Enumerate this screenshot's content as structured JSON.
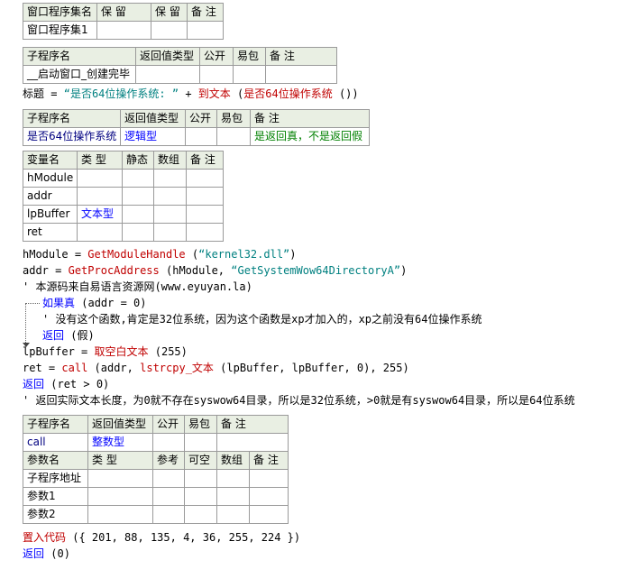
{
  "t1": {
    "header": [
      "窗口程序集名",
      "保 留",
      "保 留",
      "备 注"
    ],
    "row": [
      "窗口程序集1",
      "",
      "",
      ""
    ]
  },
  "t2": {
    "header": [
      "子程序名",
      "返回值类型",
      "公开",
      "易包",
      "备 注"
    ],
    "row": [
      "__启动窗口_创建完毕",
      "",
      "",
      "",
      ""
    ]
  },
  "line_title": {
    "target": "标题",
    "op": "=",
    "str": "“是否64位操作系统: ”",
    "plus": "+",
    "fn": "到文本",
    "arg_open": "(",
    "arg": "是否64位操作系统",
    "arg_close": "())"
  },
  "t3": {
    "header": [
      "子程序名",
      "返回值类型",
      "公开",
      "易包",
      "备 注"
    ],
    "row": [
      "是否64位操作系统",
      "逻辑型",
      "",
      "",
      "是返回真，不是返回假"
    ]
  },
  "t4": {
    "header": [
      "变量名",
      "类 型",
      "静态",
      "数组",
      "备 注"
    ],
    "rows": [
      [
        "hModule",
        "",
        "",
        "",
        ""
      ],
      [
        "addr",
        "",
        "",
        "",
        ""
      ],
      [
        "lpBuffer",
        "文本型",
        "",
        "",
        ""
      ],
      [
        "ret",
        "",
        "",
        "",
        ""
      ]
    ]
  },
  "code": {
    "l1": {
      "a": "hModule",
      "op": "=",
      "fn": "GetModuleHandle",
      "rest_a": "(",
      "str": "“kernel32.dll”",
      "rest_b": ")"
    },
    "l2": {
      "a": "addr",
      "op": "=",
      "fn": "GetProcAddress",
      "rest_a": "(hModule,",
      "str": "“GetSystemWow64DirectoryA”",
      "rest_b": ")"
    },
    "l3": "' 本源码来自易语言资源网(www.eyuyan.la)",
    "l4": {
      "kw": "如果真",
      "rest": "(addr = 0)"
    },
    "l5": "' 没有这个函数,肯定是32位系统，因为这个函数是xp才加入的，xp之前没有64位操作系统",
    "l6": {
      "kw": "返回",
      "rest": "(假)"
    },
    "l7": {
      "a": "lpBuffer",
      "op": "=",
      "fn": "取空白文本",
      "rest": "(255)"
    },
    "l8": {
      "a": "ret",
      "op": "=",
      "fn": "call",
      "rest_a": "(addr,",
      "fn2": "lstrcpy_文本",
      "rest_b": "(lpBuffer, lpBuffer, 0), 255)"
    },
    "l9": {
      "kw": "返回",
      "rest": "(ret > 0)"
    },
    "l10": "' 返回实际文本长度，为0就不存在syswow64目录，所以是32位系统，>0就是有syswow64目录，所以是64位系统"
  },
  "t5": {
    "header": [
      "子程序名",
      "返回值类型",
      "公开",
      "易包",
      "备 注"
    ],
    "row": [
      "call",
      "整数型",
      "",
      "",
      ""
    ],
    "param_header": [
      "参数名",
      "类 型",
      "参考",
      "可空",
      "数组",
      "备 注"
    ],
    "params": [
      [
        "子程序地址",
        "",
        "",
        "",
        "",
        ""
      ],
      [
        "参数1",
        "",
        "",
        "",
        "",
        ""
      ],
      [
        "参数2",
        "",
        "",
        "",
        "",
        ""
      ]
    ]
  },
  "code2": {
    "l1": {
      "fn": "置入代码",
      "rest": "({ 201, 88, 135, 4, 36, 255, 224 })"
    },
    "l2": {
      "kw": "返回",
      "rest": "(0)"
    }
  }
}
